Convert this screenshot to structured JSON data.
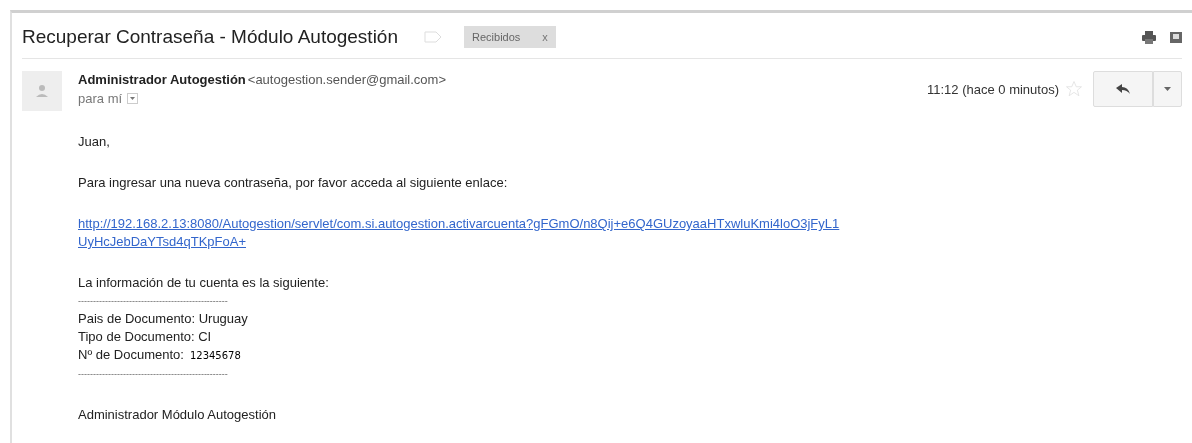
{
  "subject": "Recuperar Contraseña - Módulo Autogestión",
  "labels": [
    {
      "text": "Recibidos",
      "close": "x"
    }
  ],
  "sender": {
    "name": "Administrador Autogestión",
    "email": "<autogestion.sender@gmail.com>",
    "to": "para mí",
    "time": "11:12 (hace 0 minutos)",
    "starred": false
  },
  "body": [
    [
      {
        "kind": "text",
        "text": "Juan,"
      }
    ],
    [
      {
        "kind": "text",
        "text": "Para ingresar una nueva contraseña, por favor acceda al siguiente enlace:"
      }
    ],
    [
      {
        "kind": "link",
        "lines": [
          "http://192.168.2.13:8080/Autogestion/servlet/com.si.autogestion.activarcuenta?gFGmO/n8Qij+e6Q4GUzoyaaHTxwluKmi4loO3jFyL1",
          "UyHcJebDaYTsd4qTKpFoA+"
        ]
      }
    ],
    [
      {
        "kind": "text",
        "text": "La información de tu cuenta es la siguiente:"
      },
      {
        "kind": "divider",
        "text": "--------------------------------------------------"
      },
      {
        "kind": "text",
        "text": "Pais de Documento: Uruguay"
      },
      {
        "kind": "text",
        "text": "Tipo de Documento: CI"
      },
      {
        "kind": "field",
        "label": "Nº de Documento:",
        "value": "12345678"
      },
      {
        "kind": "divider",
        "text": "--------------------------------------------------"
      }
    ],
    [
      {
        "kind": "text",
        "text": "Administrador Módulo Autogestión"
      }
    ]
  ]
}
